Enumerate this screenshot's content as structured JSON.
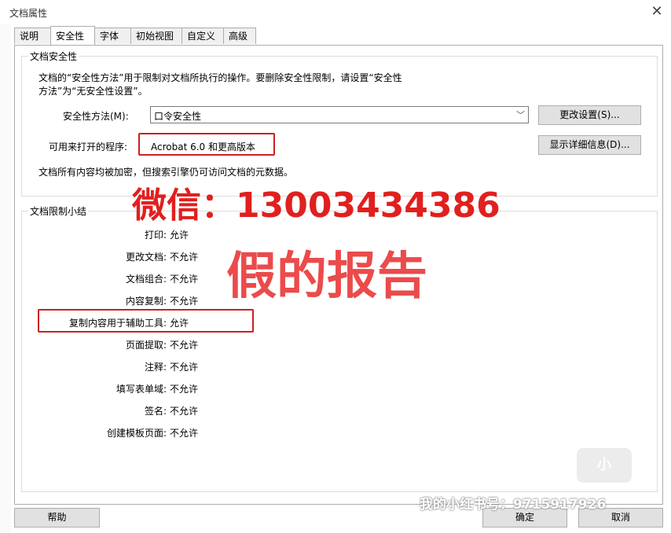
{
  "window": {
    "title": "文档属性"
  },
  "tabs": [
    {
      "label": "说明"
    },
    {
      "label": "安全性"
    },
    {
      "label": "字体"
    },
    {
      "label": "初始视图"
    },
    {
      "label": "自定义"
    },
    {
      "label": "高级"
    }
  ],
  "security_group": {
    "title": "文档安全性",
    "description_line1": "文档的“安全性方法”用于限制对文档所执行的操作。要删除安全性限制，请设置“安全性",
    "description_line2": "方法”为“无安全性设置”。",
    "method_label": "安全性方法(M):",
    "method_value": "口令安全性",
    "change_button": "更改设置(S)...",
    "open_with_label": "可用来打开的程序:",
    "open_with_value": "Acrobat 6.0 和更高版本",
    "details_button": "显示详细信息(D)...",
    "encryption_note": "文档所有内容均被加密，但搜索引擎仍可访问文档的元数据。"
  },
  "restrictions_group": {
    "title": "文档限制小结",
    "rows": [
      {
        "label": "打印:",
        "value": "允许"
      },
      {
        "label": "更改文档:",
        "value": "不允许"
      },
      {
        "label": "文档组合:",
        "value": "不允许"
      },
      {
        "label": "内容复制:",
        "value": "不允许"
      },
      {
        "label": "复制内容用于辅助工具:",
        "value": "允许"
      },
      {
        "label": "页面提取:",
        "value": "不允许"
      },
      {
        "label": "注释:",
        "value": "不允许"
      },
      {
        "label": "填写表单域:",
        "value": "不允许"
      },
      {
        "label": "签名:",
        "value": "不允许"
      },
      {
        "label": "创建模板页面:",
        "value": "不允许"
      }
    ]
  },
  "footer": {
    "help_button": "帮助",
    "ok_button": "确定",
    "cancel_button": "取消"
  },
  "overlays": {
    "wechat": "微信：13003434386",
    "fake_report": "假的报告",
    "xiaohongshu": "我的小红书号：9715917926"
  },
  "colors": {
    "annotation_red": "#cc2020",
    "watermark_red": "#e0201f"
  }
}
